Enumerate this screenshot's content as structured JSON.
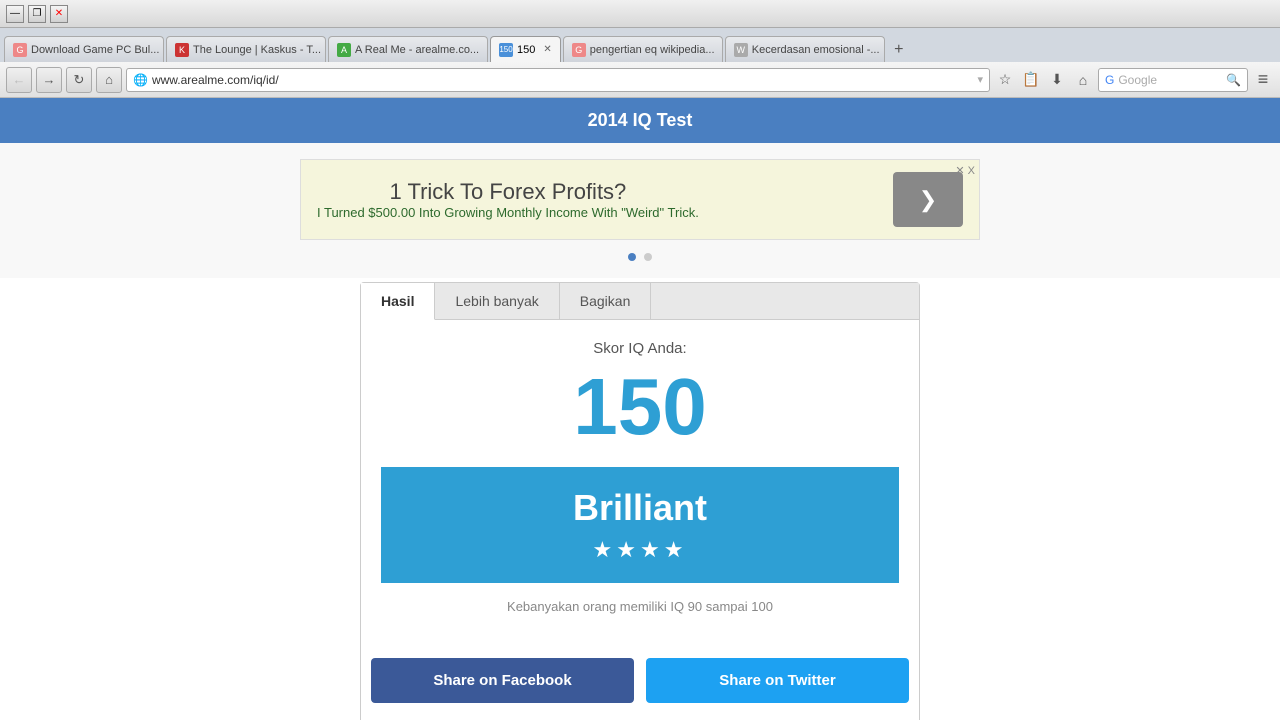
{
  "browser": {
    "tabs": [
      {
        "id": "tab1",
        "label": "Download Game PC Bul...",
        "favicon": "G",
        "active": false
      },
      {
        "id": "tab2",
        "label": "The Lounge | Kaskus - T...",
        "favicon": "K",
        "active": false
      },
      {
        "id": "tab3",
        "label": "A Real Me - arealme.co...",
        "favicon": "A",
        "active": false
      },
      {
        "id": "tab4",
        "label": "150",
        "favicon": "150",
        "active": true
      },
      {
        "id": "tab5",
        "label": "pengertian eq wikipedia...",
        "favicon": "G",
        "active": false
      },
      {
        "id": "tab6",
        "label": "Kecerdasan emosional -...",
        "favicon": "W",
        "active": false
      }
    ],
    "address": "www.arealme.com/iq/id/",
    "search_placeholder": "Google"
  },
  "site": {
    "header_title": "2014 IQ Test"
  },
  "ad": {
    "title": "1 Trick To Forex Profits?",
    "subtitle": "I Turned $500.00 Into Growing Monthly Income With \"Weird\" Trick.",
    "btn_arrow": "❯",
    "close_label": "✕ X"
  },
  "card": {
    "tabs": [
      {
        "id": "hasil",
        "label": "Hasil",
        "active": true
      },
      {
        "id": "lebih",
        "label": "Lebih banyak",
        "active": false
      },
      {
        "id": "bagikan",
        "label": "Bagikan",
        "active": false
      }
    ],
    "score_label": "Skor IQ Anda:",
    "score_value": "150",
    "result_title": "Brilliant",
    "result_stars": "★★★★",
    "result_description": "Kebanyakan orang memiliki IQ 90 sampai 100",
    "share_facebook_label": "Share on Facebook",
    "share_twitter_label": "Share on Twitter"
  },
  "colors": {
    "site_header_bg": "#4a7fc1",
    "score_color": "#2e9fd4",
    "banner_bg": "#2e9fd4",
    "facebook_btn": "#3b5998",
    "twitter_btn": "#1da1f2"
  }
}
